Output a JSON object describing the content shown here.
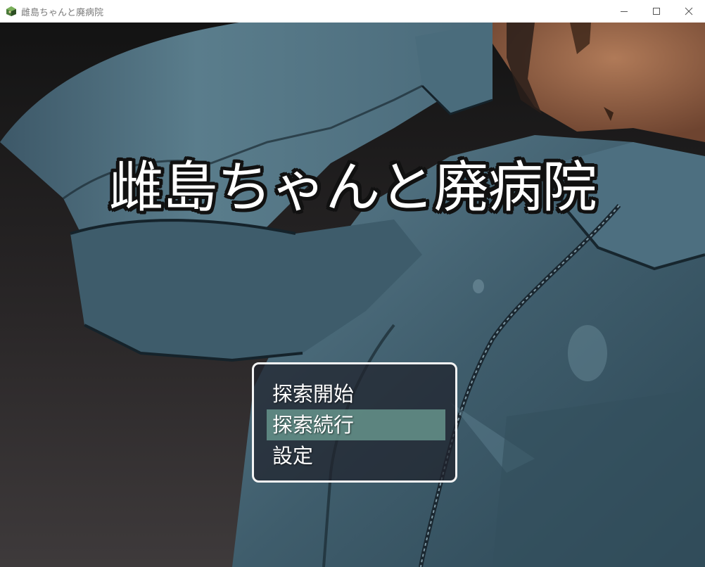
{
  "window": {
    "title": "雌島ちゃんと廃病院",
    "controls": {
      "minimize_icon": "minimize-icon",
      "maximize_icon": "maximize-icon",
      "close_icon": "close-icon"
    }
  },
  "game": {
    "title": "雌島ちゃんと廃病院",
    "menu": {
      "items": [
        {
          "label": "探索開始",
          "selected": false
        },
        {
          "label": "探索続行",
          "selected": true
        },
        {
          "label": "設定",
          "selected": false
        }
      ]
    }
  },
  "colors": {
    "menu_border": "#f4f4f4",
    "menu_highlight": "#6ea096",
    "jacket": "#3a5564",
    "background_dark": "#1c1c1e"
  }
}
